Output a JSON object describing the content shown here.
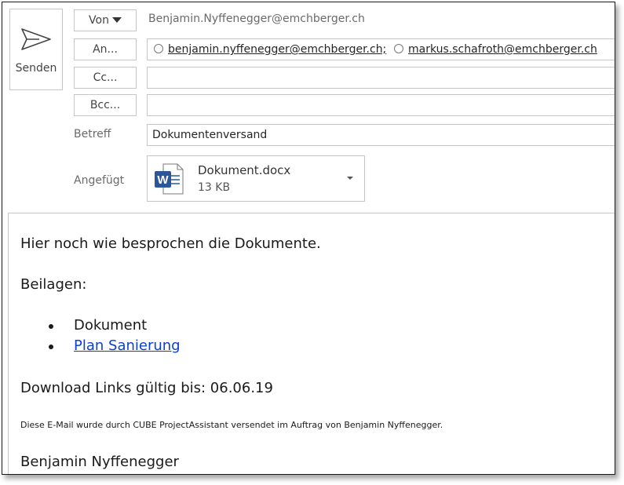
{
  "send": {
    "label": "Senden"
  },
  "from": {
    "button_label": "Von",
    "address": "Benjamin.Nyffenegger@emchberger.ch"
  },
  "to": {
    "button_label": "An...",
    "recipients": [
      "benjamin.nyffenegger@emchberger.ch;",
      "markus.schafroth@emchberger.ch"
    ]
  },
  "cc": {
    "button_label": "Cc...",
    "value": ""
  },
  "bcc": {
    "button_label": "Bcc...",
    "value": ""
  },
  "subject": {
    "label": "Betreff",
    "value": "Dokumentenversand"
  },
  "attachments": {
    "label": "Angefügt",
    "items": [
      {
        "name": "Dokument.docx",
        "size": "13 KB",
        "icon": "word-doc-icon"
      }
    ]
  },
  "body": {
    "intro": "Hier noch wie besprochen die Dokumente.",
    "enclosures_heading": "Beilagen:",
    "enclosures": [
      "Dokument",
      "Plan Sanierung"
    ],
    "validity": "Download Links gültig bis: 06.06.19",
    "notice": "Diese E-Mail wurde durch CUBE ProjectAssistant versendet im Auftrag von Benjamin Nyffenegger.",
    "signature": "Benjamin Nyffenegger"
  },
  "colors": {
    "link": "#0b3fd3",
    "word_blue": "#2b579a",
    "border": "#c6c6c6"
  }
}
